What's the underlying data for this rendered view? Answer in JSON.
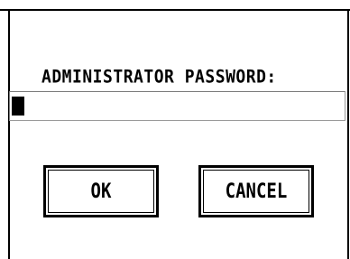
{
  "dialog": {
    "prompt_label": "ADMINISTRATOR PASSWORD:",
    "password_value": ""
  },
  "buttons": {
    "ok_label": "OK",
    "cancel_label": "CANCEL"
  },
  "colors": {
    "background": "#ffffff",
    "foreground": "#000000",
    "field_border": "#9a9a9a"
  }
}
